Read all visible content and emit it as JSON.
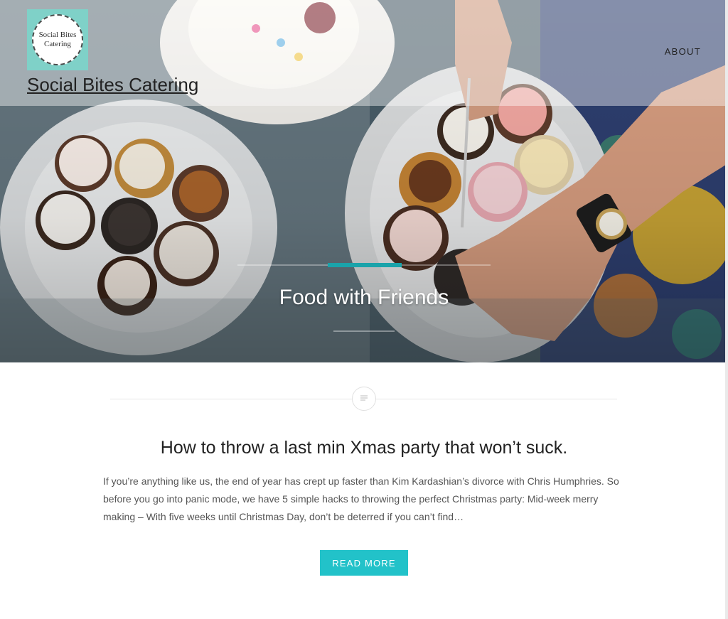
{
  "header": {
    "logo_line1": "Social Bites",
    "logo_line2": "Catering",
    "site_title": "Social Bites Catering",
    "nav": [
      {
        "label": "ABOUT"
      }
    ]
  },
  "hero": {
    "title": "Food with Friends"
  },
  "post": {
    "format_icon": "document-icon",
    "title": "How to throw a last min Xmas party that won’t suck.",
    "excerpt": "If you’re anything like us, the end of year has crept up faster than Kim Kardashian’s divorce with Chris Humphries. So before you go into panic mode, we have 5 simple hacks to throwing the perfect Christmas party: Mid-week merry making – With five weeks until Christmas Day, don’t be deterred if you can’t find…",
    "read_more_label": "READ MORE"
  },
  "colors": {
    "accent": "#22c2c9",
    "logo_bg": "#7fd1c8",
    "hero_underline": "#1aa3aa"
  }
}
